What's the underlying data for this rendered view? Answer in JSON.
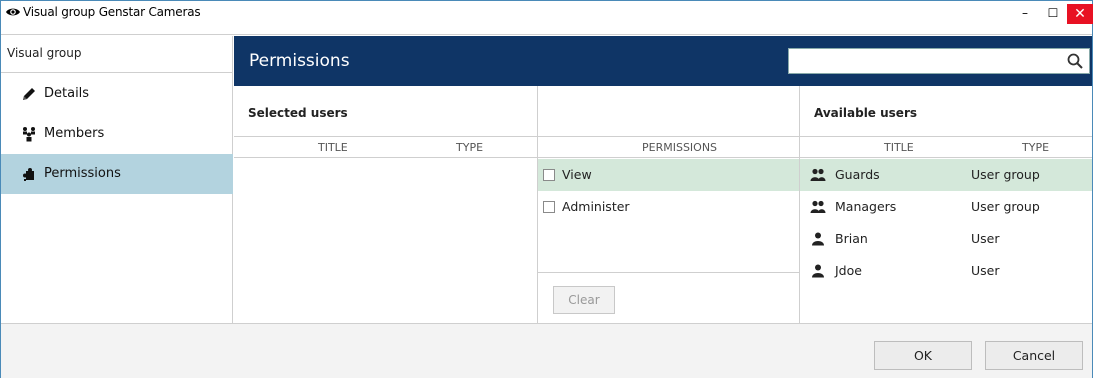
{
  "window": {
    "title": "Visual group Genstar Cameras",
    "minimize_glyph": "–",
    "maximize_glyph": "☐",
    "close_glyph": "✕",
    "accent_color": "#0f3566",
    "selected_row_color": "#d4e8da",
    "active_nav_color": "#b3d3df"
  },
  "sidebar": {
    "heading": "Visual group",
    "items": [
      {
        "label": "Details",
        "icon": "pencil-icon"
      },
      {
        "label": "Members",
        "icon": "members-icon"
      },
      {
        "label": "Permissions",
        "icon": "puzzle-icon",
        "active": true
      }
    ]
  },
  "header": {
    "title": "Permissions",
    "search": {
      "placeholder": "",
      "value": "",
      "icon": "search-icon"
    }
  },
  "selected_users": {
    "title": "Selected users",
    "columns": [
      "TITLE",
      "TYPE"
    ],
    "rows": []
  },
  "permissions": {
    "column": "PERMISSIONS",
    "items": [
      {
        "label": "View",
        "checked": false,
        "selected": true
      },
      {
        "label": "Administer",
        "checked": false,
        "selected": false
      }
    ],
    "clear_label": "Clear"
  },
  "available_users": {
    "title": "Available users",
    "columns": [
      "TITLE",
      "TYPE"
    ],
    "rows": [
      {
        "name": "Guards",
        "type": "User group",
        "icon": "user-group-icon",
        "selected": true
      },
      {
        "name": "Managers",
        "type": "User group",
        "icon": "user-group-icon",
        "selected": false
      },
      {
        "name": "Brian",
        "type": "User",
        "icon": "user-icon",
        "selected": false
      },
      {
        "name": "Jdoe",
        "type": "User",
        "icon": "user-icon",
        "selected": false
      }
    ]
  },
  "footer": {
    "ok_label": "OK",
    "cancel_label": "Cancel"
  }
}
